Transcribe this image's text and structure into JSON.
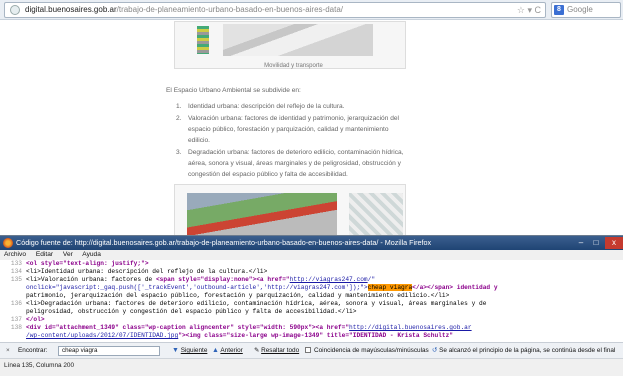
{
  "browser": {
    "url_domain": "digital.buenosaires.gob.ar",
    "url_path": "/trabajo-de-planeamiento-urbano-basado-en-buenos-aires-data/",
    "url_tools": "☆ ▾ C",
    "search_placeholder": "Google",
    "search_engine_letter": "8"
  },
  "article": {
    "figure1_caption": "Movilidad y transporte",
    "intro": "El Espacio Urbano Ambiental se subdivide en:",
    "items": [
      {
        "num": "1.",
        "text": "Identidad urbana: descripción del reflejo de la cultura."
      },
      {
        "num": "2.",
        "text": "Valoración urbana: factores de identidad y patrimonio, jerarquización del espacio público, forestación y parquización, calidad y mantenimiento edilicio."
      },
      {
        "num": "3.",
        "text": "Degradación urbana: factores de deterioro edilicio, contaminación hídrica, aérea, sonora y visual, áreas marginales y de peligrosidad, obstrucción y congestión del espacio público y falta de accesibilidad."
      }
    ]
  },
  "source_window": {
    "title": "Código fuente de: http://digital.buenosaires.gob.ar/trabajo-de-planeamiento-urbano-basado-en-buenos-aires-data/ - Mozilla Firefox",
    "buttons": {
      "minimize": "–",
      "maximize": "□",
      "close": "x"
    },
    "menu": [
      "Archivo",
      "Editar",
      "Ver",
      "Ayuda"
    ],
    "lines": {
      "l1": {
        "n": "133",
        "text": "<ol style=\"text-align: justify;\">"
      },
      "l2": {
        "n": "134",
        "text": "<li>Identidad urbana: descripción del reflejo de la cultura.</li>"
      },
      "l3": {
        "n": "135",
        "pre": "<li>Valoración urbana: factores de ",
        "span": "<span style=\"display:none\"><a href=\"",
        "link1": "http://viagras247.com",
        "post1": "/\"",
        "highlight": "cheap viagra",
        "post2": "</a></span> identidad y"
      },
      "l3b": {
        "text": "onclick=\"javascript:_gaq.push(['_trackEvent','outbound-article','http://viagras247.com']);\">"
      },
      "l3c": {
        "text": "patrimonio, jerarquización del espacio público, forestación y parquización, calidad y mantenimiento edilicio.</li>"
      },
      "l4": {
        "n": "136",
        "text": "<li>Degradación urbana: factores de deterioro edilicio, contaminación hídrica, aérea, sonora y visual, áreas marginales y de"
      },
      "l4b": {
        "text": "peligrosidad, obstrucción y congestión del espacio público y falta de accesibilidad.</li>"
      },
      "l5": {
        "n": "137",
        "text": "</ol>"
      },
      "l6": {
        "n": "138",
        "pre": "<div id=\"attachment_1349\" class=\"wp-caption aligncenter\" style=\"width: 590px\"><a href=\"",
        "link": "http://digital.buenosaires.gob.ar"
      },
      "l6b": {
        "link": "/wp-content/uploads/2012/07/IDENTIDAD.jpg",
        "post": "\"><img class=\"size-large wp-image-1349\" title=\"IDENTIDAD - Krista Schultz\""
      }
    },
    "findbar": {
      "close": "×",
      "label": "Encontrar:",
      "value": "cheap viagra",
      "next": "Siguiente",
      "prev": "Anterior",
      "highlight_all": "Resaltar todo",
      "match_case": "Coincidencia de mayúsculas/minúsculas",
      "message": "Se alcanzó el principio de la página, se continúa desde el final"
    },
    "status": "Línea 135, Columna 200"
  }
}
